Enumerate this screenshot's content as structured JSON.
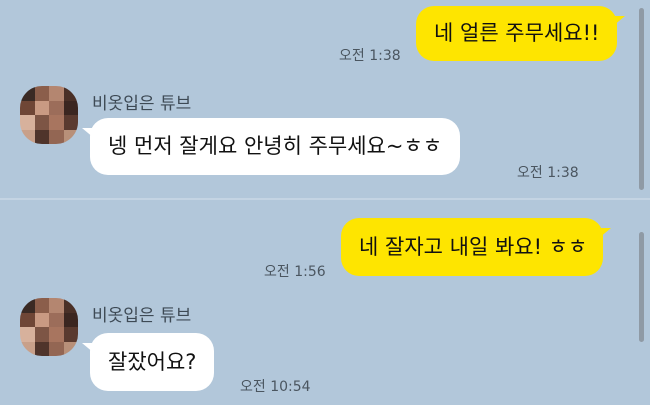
{
  "chat": {
    "background_color": "#b2c7da",
    "outgoing_color": "#fee500",
    "incoming_color": "#ffffff",
    "messages": [
      {
        "direction": "outgoing",
        "text": "네 얼른 주무세요!!",
        "time": "오전 1:38"
      },
      {
        "direction": "incoming",
        "sender": "비옷입은 튜브",
        "text": "넹 먼저 잘게요 안녕히 주무세요~ㅎㅎ",
        "time": "오전 1:38"
      },
      {
        "direction": "outgoing",
        "text": "네 잘자고 내일 봐요! ㅎㅎ",
        "time": "오전 1:56"
      },
      {
        "direction": "incoming",
        "sender": "비옷입은 튜브",
        "text": "잘잤어요?",
        "time": "오전 10:54"
      }
    ]
  },
  "avatar_icon": "pixelated-profile-icon"
}
